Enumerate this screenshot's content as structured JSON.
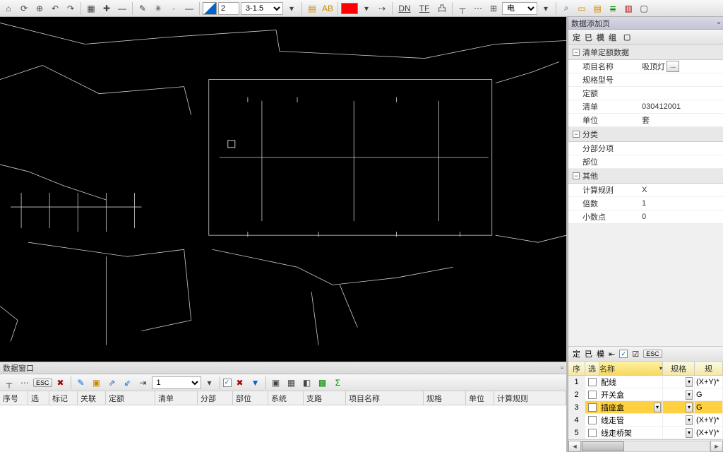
{
  "toolbar": {
    "num_input": "2",
    "wire_combo": "3-1.5",
    "layer_combo": "电"
  },
  "side": {
    "panel_title": "数据添加页",
    "tabs": {
      "t1": "定",
      "t2": "已",
      "t3": "模",
      "t4": "组"
    },
    "sections": {
      "list_quota": "清单定额数据",
      "category": "分类",
      "other": "其他"
    },
    "props": {
      "project_name_label": "项目名称",
      "project_name_value": "吸顶灯",
      "spec_label": "规格型号",
      "spec_value": "",
      "quota_label": "定额",
      "quota_value": "",
      "list_label": "清单",
      "list_value": "030412001",
      "unit_label": "单位",
      "unit_value": "套",
      "sub_label": "分部分项",
      "sub_value": "",
      "pos_label": "部位",
      "pos_value": "",
      "rule_label": "计算规则",
      "rule_value": "X",
      "mult_label": "倍数",
      "mult_value": "1",
      "dec_label": "小数点",
      "dec_value": "0"
    },
    "grid_tabs": {
      "t1": "定",
      "t2": "已",
      "t3": "模",
      "esc": "ESC"
    },
    "grid_head": {
      "seq": "序",
      "sel": "选",
      "name": "名称",
      "spec": "规格",
      "ru": "规"
    },
    "grid_rows": [
      {
        "n": "1",
        "name": "配线",
        "spec": "",
        "rule": "(X+Y)*"
      },
      {
        "n": "2",
        "name": "开关盒",
        "spec": "",
        "rule": "G"
      },
      {
        "n": "3",
        "name": "插座盒",
        "spec": "",
        "rule": "G"
      },
      {
        "n": "4",
        "name": "线走管",
        "spec": "",
        "rule": "(X+Y)*"
      },
      {
        "n": "5",
        "name": "线走桥架",
        "spec": "",
        "rule": "(X+Y)*"
      }
    ]
  },
  "dw": {
    "caption": "数据窗口",
    "combo": "1",
    "headers": {
      "seq": "序号",
      "sel": "选",
      "mark": "标记",
      "link": "关联",
      "quota": "定额",
      "list": "清单",
      "part": "分部",
      "pos": "部位",
      "sys": "系统",
      "branch": "支路",
      "proj": "项目名称",
      "spec": "规格",
      "unit": "单位",
      "rule": "计算规则"
    }
  },
  "icons": {
    "home": "⌂",
    "refresh": "⟳",
    "target": "⊕",
    "undo": "↶",
    "redo": "↷",
    "grid": "▦",
    "cross": "✚",
    "line": "—",
    "pen": "✎",
    "snap": "✳",
    "dot": "·",
    "swatch": "◪",
    "calc": "▤",
    "text": "AB",
    "link": "⇢",
    "dn": "DN",
    "tf": "TF",
    "sq": "凸",
    "tree": "┬",
    "dots": "⋯",
    "plus": "⊞",
    "find": "⌕",
    "folder": "▭",
    "note": "▤",
    "ruler": "≣",
    "bars": "▥",
    "doc": "▢",
    "pin": "📌",
    "esc": "ESC",
    "check": "✓",
    "xred": "✖",
    "filter": "▼",
    "tool1": "▣",
    "tool2": "▦",
    "tool3": "◧",
    "xls": "▩",
    "sum": "Σ",
    "indent": "⇥",
    "outdent": "⇤",
    "listchk": "☑",
    "dd": "▾"
  }
}
